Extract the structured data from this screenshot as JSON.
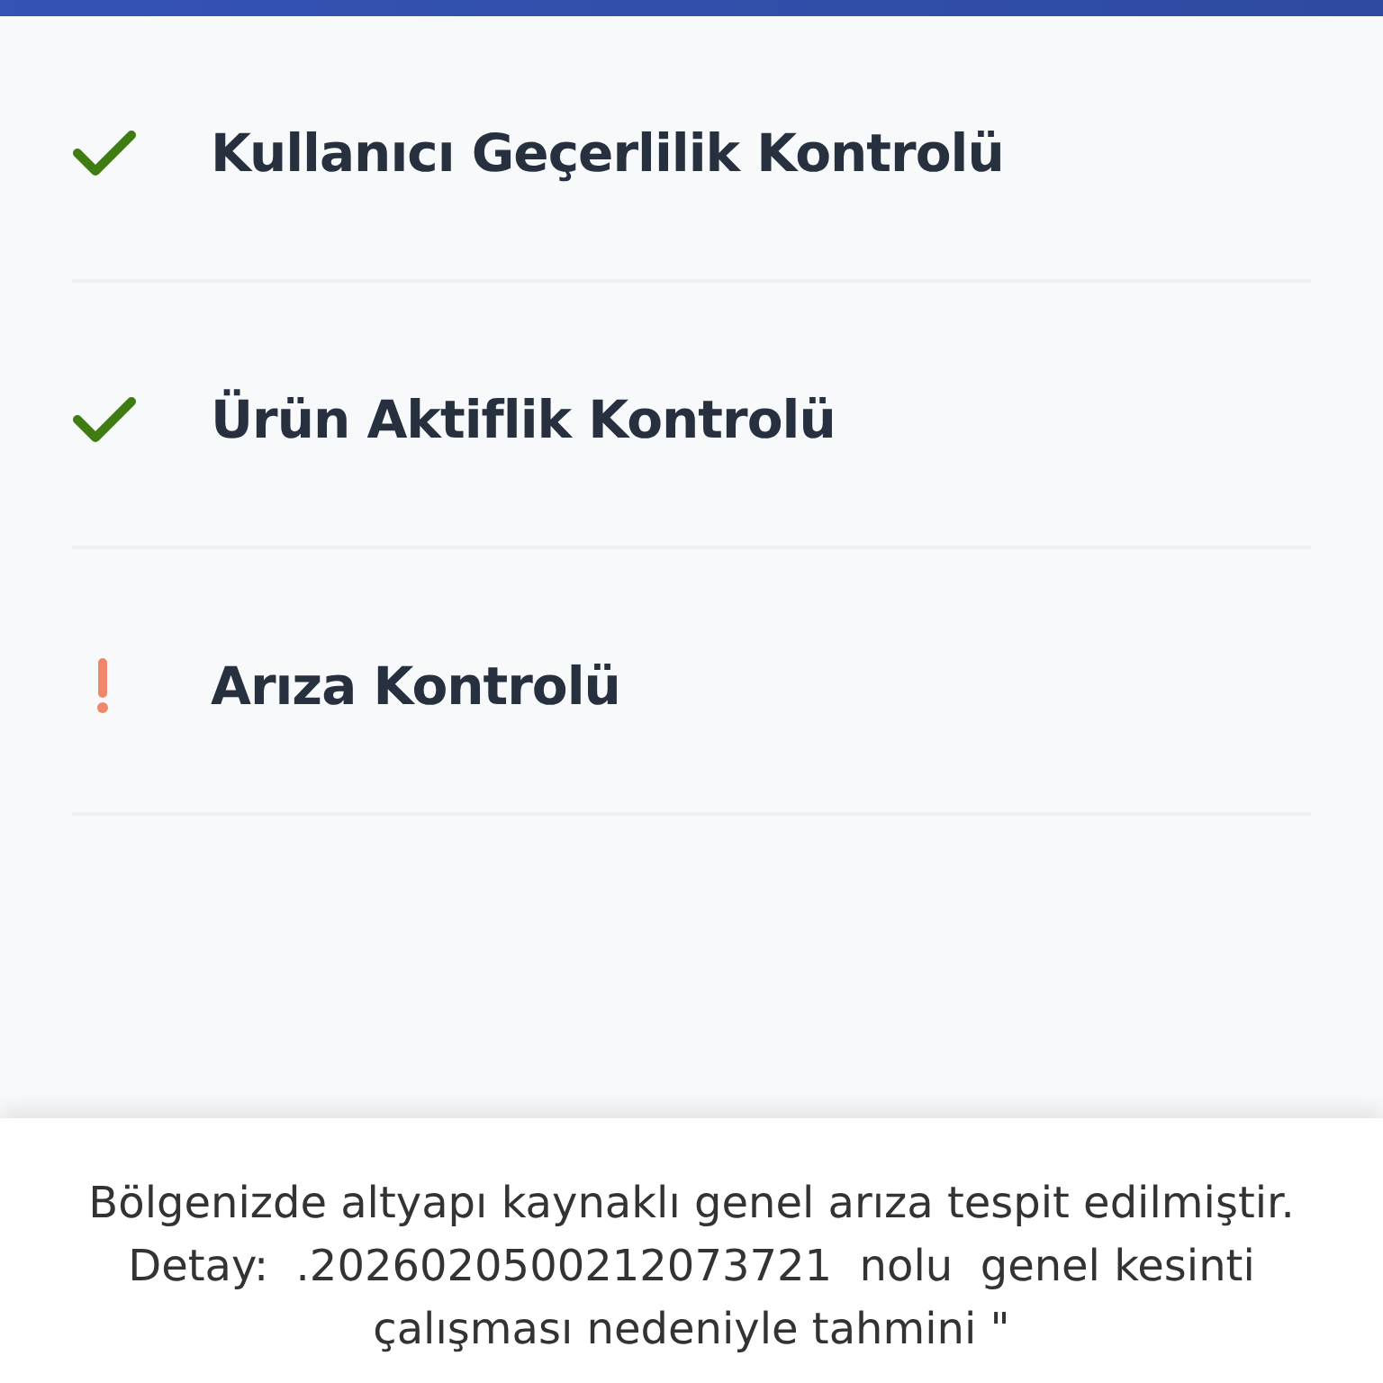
{
  "checks": [
    {
      "label": "Kullanıcı Geçerlilik Kontrolü",
      "kind": "ok"
    },
    {
      "label": "Ürün Aktiflik Kontrolü",
      "kind": "ok"
    },
    {
      "label": "Arıza Kontrolü",
      "kind": "warning"
    }
  ],
  "message": "Bölgenizde altyapı kaynaklı genel arıza tespit edilmiştir. Detay:  .2026020500212073721  nolu  genel kesinti  çalışması nedeniyle tahmini \""
}
